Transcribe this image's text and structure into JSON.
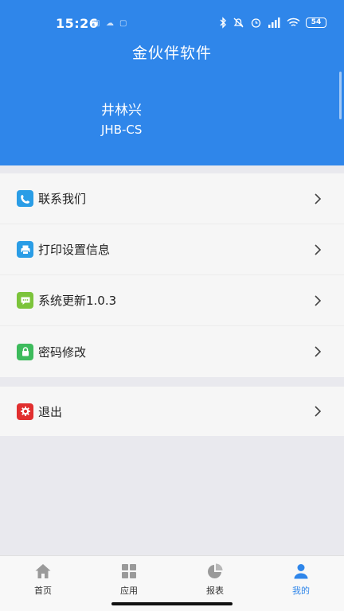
{
  "status_bar": {
    "time": "15:26",
    "notif_icons": [
      "camera-icon",
      "cloud-icon",
      "app-icon"
    ],
    "battery": "54"
  },
  "header": {
    "title": "金伙伴软件",
    "user_name": "井林兴",
    "user_code": "JHB-CS",
    "color": "#2f86ea"
  },
  "menu": {
    "items": [
      {
        "label": "联系我们",
        "icon": "phone-icon",
        "color": "#2a9de6"
      },
      {
        "label": "打印设置信息",
        "icon": "printer-icon",
        "color": "#2a9de6"
      },
      {
        "label": "系统更新1.0.3",
        "icon": "message-icon",
        "color": "#7cc43b"
      },
      {
        "label": "密码修改",
        "icon": "lock-icon",
        "color": "#3dbb5c"
      }
    ],
    "logout": {
      "label": "退出",
      "icon": "gear-icon",
      "color": "#e12f2f"
    }
  },
  "tabbar": {
    "tabs": [
      {
        "label": "首页",
        "icon": "home-icon",
        "active": false
      },
      {
        "label": "应用",
        "icon": "apps-icon",
        "active": false
      },
      {
        "label": "报表",
        "icon": "pie-chart-icon",
        "active": false
      },
      {
        "label": "我的",
        "icon": "user-icon",
        "active": true
      }
    ],
    "active_color": "#2f86ea",
    "inactive_color": "#9a9a9a"
  }
}
